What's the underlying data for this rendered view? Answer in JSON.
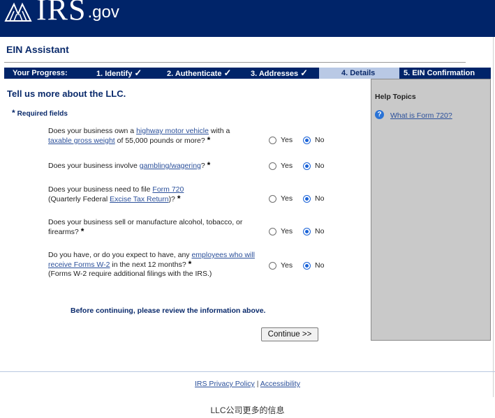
{
  "header": {
    "logo_text": "IRS",
    "logo_domain": ".gov"
  },
  "app_title": "EIN Assistant",
  "progress": {
    "label": "Your Progress:",
    "steps": [
      {
        "label": "1. Identify",
        "done": true
      },
      {
        "label": "2. Authenticate",
        "done": true
      },
      {
        "label": "3. Addresses",
        "done": true
      },
      {
        "label": "4. Details",
        "current": true
      },
      {
        "label": "5. EIN Confirmation"
      }
    ],
    "check_glyph": "✓"
  },
  "main": {
    "section_title": "Tell us more about the LLC.",
    "required_note": "Required fields",
    "required_star": "*",
    "questions": [
      {
        "p1": "Does your business own a ",
        "link1": "highway motor vehicle",
        "p2": " with a",
        "link2": "taxable gross weight",
        "p3": " of 55,000 pounds or more? ",
        "star": "*"
      },
      {
        "p1": "Does your business involve ",
        "link1": "gambling/wagering",
        "p2": "? ",
        "star": "*"
      },
      {
        "p1": "Does your business need to file ",
        "link1": "Form 720",
        "p2": "(Quarterly Federal ",
        "link2": "Excise Tax Return",
        "p3": ")? ",
        "star": "*"
      },
      {
        "p1": "Does your business sell or manufacture alcohol, tobacco, or firearms? ",
        "star": "*"
      },
      {
        "p1": "Do you have, or do you expect to have, any ",
        "link1": "employees who will receive Forms W-2",
        "p2": " in the next 12 months? ",
        "star": "*",
        "p3": "(Forms W-2 require additional filings with the IRS.)"
      }
    ],
    "options": {
      "yes": "Yes",
      "no": "No"
    },
    "selected": [
      "No",
      "No",
      "No",
      "No",
      "No"
    ],
    "review_note": "Before continuing, please review the information above.",
    "continue_label": "Continue >>"
  },
  "help": {
    "title": "Help Topics",
    "icon_glyph": "?",
    "link": "What is Form 720?"
  },
  "footer": {
    "privacy": "IRS Privacy Policy",
    "separator": " | ",
    "accessibility": "Accessibility"
  },
  "caption": "LLC公司更多的信息",
  "colors": {
    "navy": "#002469",
    "progress_current": "#b9c9e5",
    "help_bg": "#c9c9c9",
    "link": "#2a4f9a",
    "radio_checked": "#1a63d8"
  }
}
